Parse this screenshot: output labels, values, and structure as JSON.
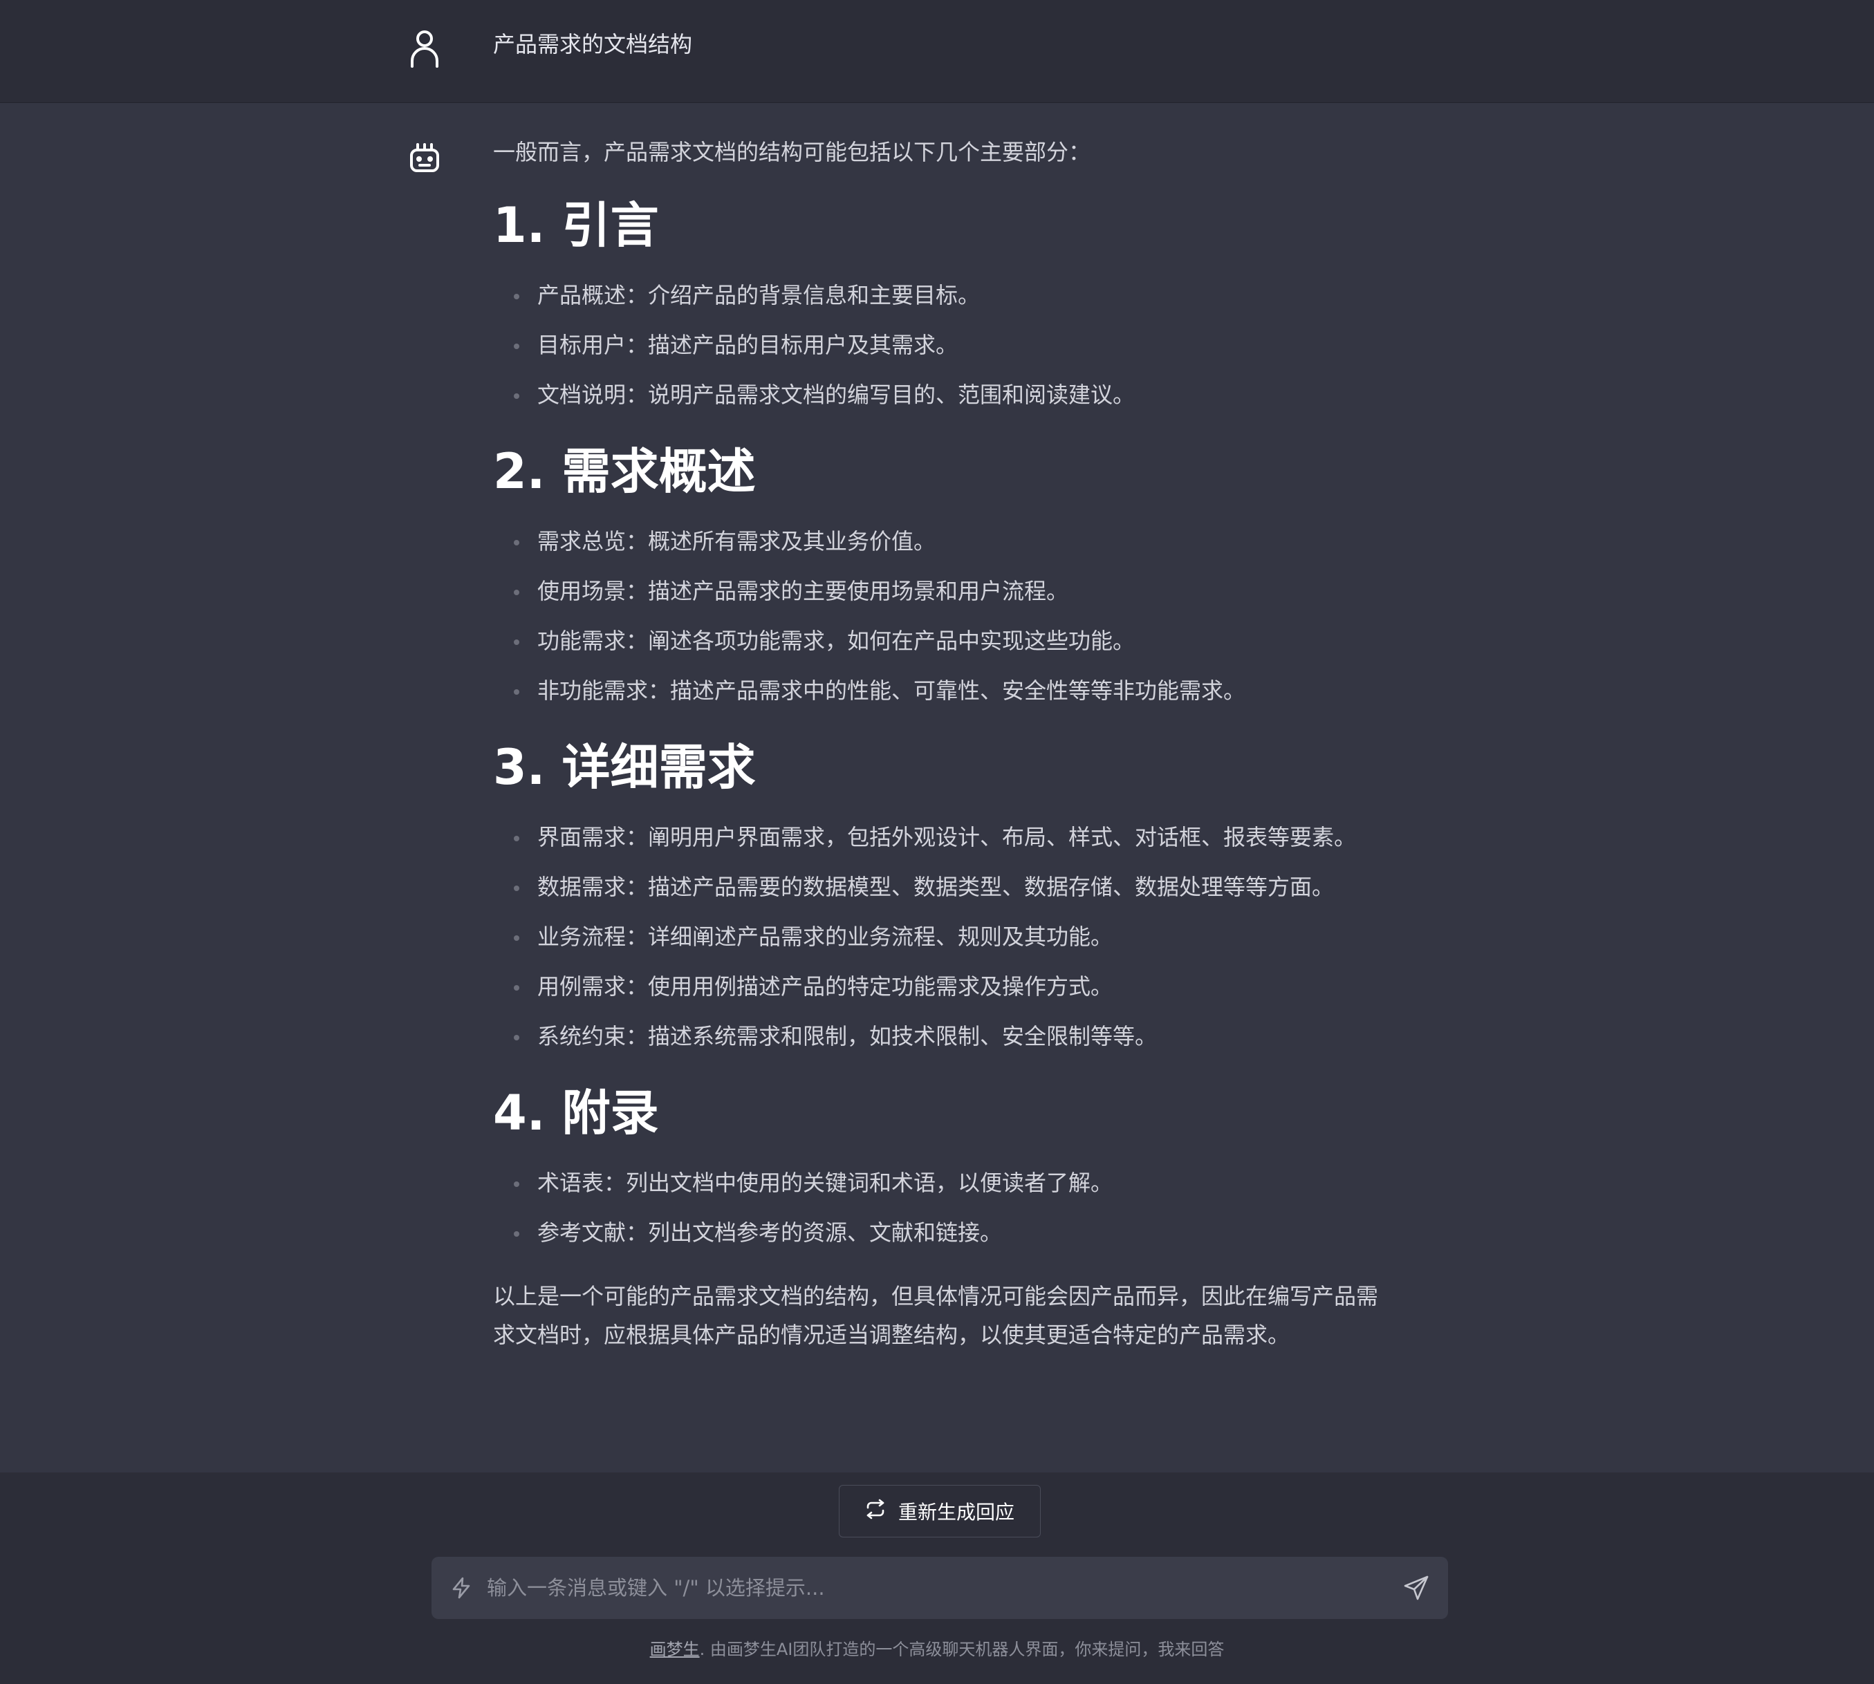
{
  "user_message": {
    "text": "产品需求的文档结构"
  },
  "assistant_message": {
    "intro": "一般而言，产品需求文档的结构可能包括以下几个主要部分：",
    "sections": [
      {
        "title": "1. 引言",
        "items": [
          "产品概述：介绍产品的背景信息和主要目标。",
          "目标用户：描述产品的目标用户及其需求。",
          "文档说明：说明产品需求文档的编写目的、范围和阅读建议。"
        ]
      },
      {
        "title": "2. 需求概述",
        "items": [
          "需求总览：概述所有需求及其业务价值。",
          "使用场景：描述产品需求的主要使用场景和用户流程。",
          "功能需求：阐述各项功能需求，如何在产品中实现这些功能。",
          "非功能需求：描述产品需求中的性能、可靠性、安全性等等非功能需求。"
        ]
      },
      {
        "title": "3. 详细需求",
        "items": [
          "界面需求：阐明用户界面需求，包括外观设计、布局、样式、对话框、报表等要素。",
          "数据需求：描述产品需要的数据模型、数据类型、数据存储、数据处理等等方面。",
          "业务流程：详细阐述产品需求的业务流程、规则及其功能。",
          "用例需求：使用用例描述产品的特定功能需求及操作方式。",
          "系统约束：描述系统需求和限制，如技术限制、安全限制等等。"
        ]
      },
      {
        "title": "4. 附录",
        "items": [
          "术语表：列出文档中使用的关键词和术语，以便读者了解。",
          "参考文献：列出文档参考的资源、文献和链接。"
        ]
      }
    ],
    "conclusion": "以上是一个可能的产品需求文档的结构，但具体情况可能会因产品而异，因此在编写产品需求文档时，应根据具体产品的情况适当调整结构，以使其更适合特定的产品需求。"
  },
  "controls": {
    "regenerate_label": "重新生成回应",
    "input_placeholder": "输入一条消息或键入 \"/\" 以选择提示...",
    "input_value": ""
  },
  "footer": {
    "link_text": "画梦生",
    "text": ". 由画梦生AI团队打造的一个高级聊天机器人界面，你来提问，我来回答"
  },
  "icons": {
    "user_avatar": "user-icon",
    "bot_avatar": "robot-icon",
    "regenerate": "refresh-icon",
    "input_prefix": "bolt-icon",
    "send": "send-icon"
  },
  "colors": {
    "header_bg": "#2c2d38",
    "answer_bg": "#343643",
    "heading": "#ffffff",
    "text": "#d3d4dc",
    "input_bg": "#3b3d4a"
  }
}
